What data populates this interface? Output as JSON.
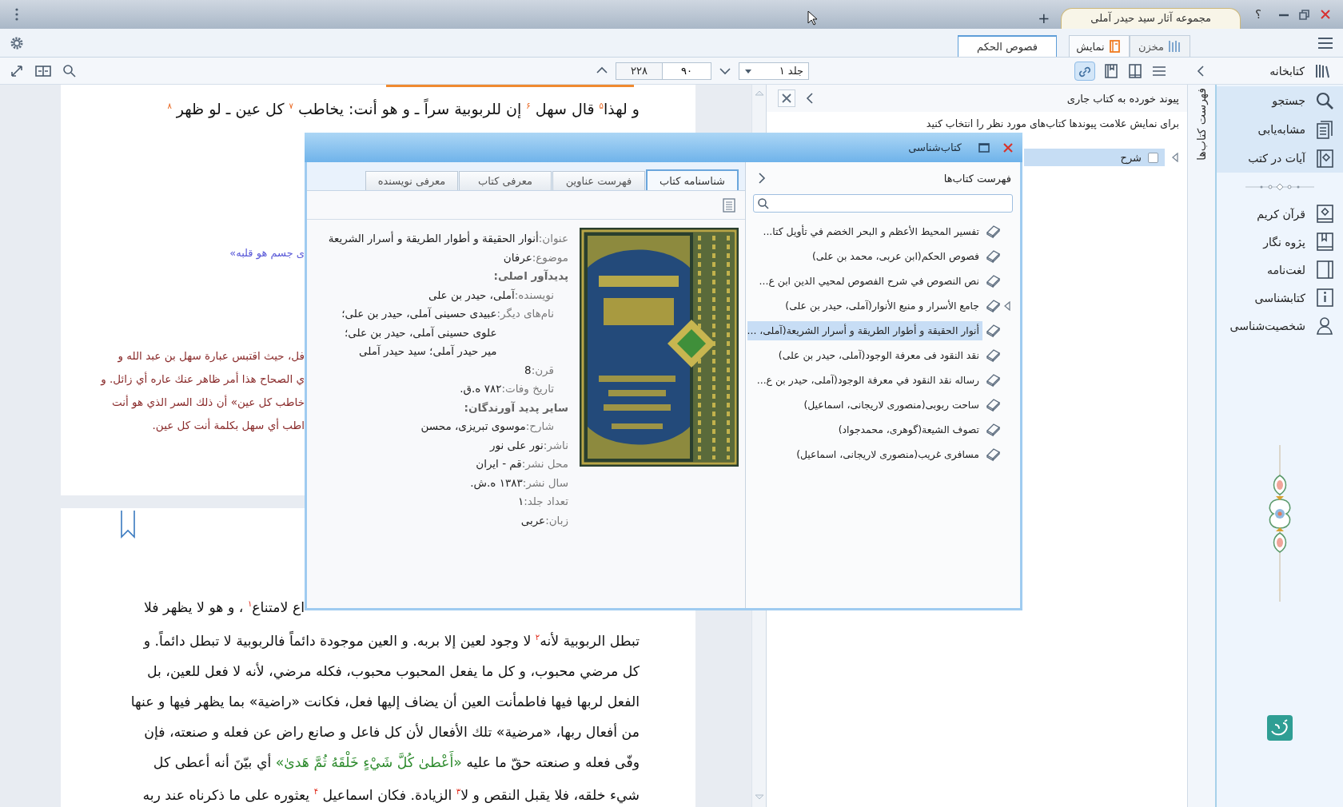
{
  "title_bar": {
    "new_tab": "+",
    "app_tab": {
      "title": "مجموعه آثار سید حیدر آملی"
    },
    "help": "؟"
  },
  "tab_bar": {
    "document_tabs": [
      {
        "label": "فصوص الحکم",
        "selected": true
      }
    ],
    "mode_tabs": [
      {
        "label": "مخزن",
        "kind": "store",
        "selected": false
      },
      {
        "label": "نمایش",
        "kind": "display",
        "selected": true
      }
    ]
  },
  "toolbar": {
    "page_count": "۲۲۸",
    "page": "۹۰",
    "volume": "جلد ۱",
    "link_toggle": {
      "on": true
    }
  },
  "document": {
    "page_1": {
      "lines": [
        {
          "kind": "full",
          "segments": [
            {
              "kind": "text",
              "text": "و لهذا$^{۵}$ قال سهل $^{۶}$ إن للربوبية سراً ـ و هو أنت: يخاطب $^{۷}$ كل عين ـ لو ظهر $^{۸}$"
            }
          ]
        }
      ],
      "quote": "ى جسم هو قلبه»",
      "notes": [
        "فل، حيث اقتبس عبارة سهل بن عبد الله و",
        "ي الصحاح هذا أمر ظاهر عنك عاره أي زائل. و",
        "خاطب كل عين» أن ذلك السر الذي هو أنت",
        "اطب أي سهل بكلمة أنت كل عين."
      ]
    },
    "page_2": {
      "lines": [
        {
          "kind": "cut",
          "segments": [
            {
              "kind": "text",
              "text": "اع لامتناع$^{۱}$ ، و هو لا يظهر فلا"
            }
          ]
        },
        {
          "kind": "full",
          "segments": [
            {
              "kind": "text",
              "text": "تبطل الربوبية لأنه$^{۲}$ لا وجود لعين إلا بربه. و العين موجودة دائماً فالربوبية لا تبطل دائماً. و"
            }
          ]
        },
        {
          "kind": "full",
          "segments": [
            {
              "kind": "text",
              "text": "كل مرضي محبوب، و كل ما يفعل المحبوب محبوب، فكله مرضي، لأنه لا فعل للعين، بل"
            }
          ]
        },
        {
          "kind": "full",
          "segments": [
            {
              "kind": "text",
              "text": "الفعل لربها فيها فاطمأنت العين أن يضاف إليها فعل، فكانت «راضية» بما يظهر فيها و عنها"
            }
          ]
        },
        {
          "kind": "full",
          "segments": [
            {
              "kind": "text",
              "text": "من أفعال ربها، «مرضية» تلك الأفعال لأن كل فاعل و صانع راض عن فعله و صنعته، فإن"
            }
          ]
        },
        {
          "kind": "full",
          "segments": [
            {
              "kind": "text",
              "text": "وفّى فعله و صنعته حقّ ما عليه "
            },
            {
              "kind": "quran",
              "text": "«أَعْطىٰ كُلَّ شَيْءٍ خَلْقَهُ ثُمَّ هَدىٰ»"
            },
            {
              "kind": "text",
              "text": " أي بيّنَ أنه أعطى كل"
            }
          ]
        },
        {
          "kind": "full",
          "segments": [
            {
              "kind": "text",
              "text": "شيء خلقه، فلا يقبل النقص و لا$^{۳}$ الزيادة. فكان اسماعيل $^{۴}$ يعثوره على ما ذكرناه عند ربه"
            }
          ]
        }
      ]
    }
  },
  "links_panel": {
    "title": "پیوند خورده به کتاب جاری",
    "hint": "برای نمایش علامت پیوندها کتاب‌های مورد نظر را انتخاب کنید",
    "items": [
      {
        "label": "شرح",
        "checked": false,
        "selected": true
      }
    ]
  },
  "side_tab": {
    "label": "فهرست کتاب‌ها"
  },
  "sidebar": {
    "title": "کتابخانه",
    "groups": [
      {
        "kind": "tools",
        "items": [
          {
            "label": "جستجو",
            "kind": "search"
          },
          {
            "label": "مشابه‌یابی",
            "kind": "similar"
          },
          {
            "label": "آیات در کتب",
            "kind": "verses"
          }
        ]
      },
      {
        "kind": "resources",
        "items": [
          {
            "label": "قرآن کریم",
            "kind": "quran"
          },
          {
            "label": "پژوه نگار",
            "kind": "notes"
          },
          {
            "label": "لغت‌نامه",
            "kind": "dictionary"
          },
          {
            "label": "کتابشناسی",
            "kind": "info"
          },
          {
            "label": "شخصیت‌شناسی",
            "kind": "person"
          }
        ]
      }
    ]
  },
  "dialog": {
    "title": "کتاب‌شناسی",
    "tabs": [
      {
        "label": "شناسنامه کتاب",
        "selected": true
      },
      {
        "label": "فهرست عناوین",
        "selected": false
      },
      {
        "label": "معرفی کتاب",
        "selected": false
      },
      {
        "label": "معرفی نویسنده",
        "selected": false
      }
    ],
    "fields": [
      {
        "kind": "field",
        "label": "عنوان:",
        "values": [
          "أنوار الحقيقة و أطوار الطريقة و أسرار الشريعة"
        ]
      },
      {
        "kind": "field",
        "label": "موضوع:",
        "values": [
          "عرفان"
        ]
      },
      {
        "kind": "heading",
        "label": "پدیدآور اصلی:",
        "children": [
          {
            "label": "نویسنده:",
            "values": [
              "آملی، حیدر بن علی"
            ]
          },
          {
            "label": "نام‌های دیگر:",
            "values": [
              "عبیدی حسینی آملی، حیدر بن علی؛",
              "علوی حسینی آملی، حیدر بن علی؛",
              "میر حیدر آملی؛ سید حیدر آملی"
            ]
          },
          {
            "label": "قرن:",
            "values": [
              "8"
            ]
          },
          {
            "label": "تاریخ وفات:",
            "values": [
              "۷۸۲ ه.ق."
            ]
          }
        ]
      },
      {
        "kind": "heading",
        "label": "سایر پدید آورندگان:",
        "children": [
          {
            "label": "شارح:",
            "values": [
              "موسوی تبریزی، محسن"
            ]
          }
        ]
      },
      {
        "kind": "field",
        "label": "ناشر:",
        "values": [
          "نور علی نور"
        ]
      },
      {
        "kind": "field",
        "label": "محل نشر:",
        "values": [
          "قم - ایران"
        ]
      },
      {
        "kind": "field",
        "label": "سال نشر:",
        "values": [
          "۱۳۸۳ ه.ش."
        ]
      },
      {
        "kind": "field",
        "label": "تعداد جلد:",
        "values": [
          "۱"
        ]
      },
      {
        "kind": "field",
        "label": "زبان:",
        "values": [
          "عربی"
        ]
      }
    ],
    "book_list": {
      "title": "فهرست کتاب‌ها",
      "items": [
        {
          "label": "تفسير المحيط الأعظم و البحر الخضم في تأويل كتا...",
          "selected": false,
          "marked": false
        },
        {
          "label": "فصوص الحكم(ابن عربی، محمد بن علی)",
          "selected": false,
          "marked": false
        },
        {
          "label": "نص النصوص في شرح الفصوص لمحيي الدين ابن ع...",
          "selected": false,
          "marked": false
        },
        {
          "label": "جامع الأسرار و منبع الأنوار(آملی، حيدر بن علی)",
          "selected": false,
          "marked": true
        },
        {
          "label": "أنوار الحقيقة و أطوار الطريقة و أسرار الشريعة(آملی، ...",
          "selected": true,
          "marked": false
        },
        {
          "label": "نقد النقود فی معرفة الوجود(آملی، حيدر بن علی)",
          "selected": false,
          "marked": false
        },
        {
          "label": "رساله نقد النقود في معرفة الوجود(آملی، حيدر بن ع...",
          "selected": false,
          "marked": false
        },
        {
          "label": "ساحت ربوبی(منصوری لاريجانی، اسماعيل)",
          "selected": false,
          "marked": false
        },
        {
          "label": "تصوف الشيعة(گوهری، محمدجواد)",
          "selected": false,
          "marked": false
        },
        {
          "label": "مسافری غريب(منصوری لاريجانی، اسماعيل)",
          "selected": false,
          "marked": false
        }
      ]
    }
  }
}
